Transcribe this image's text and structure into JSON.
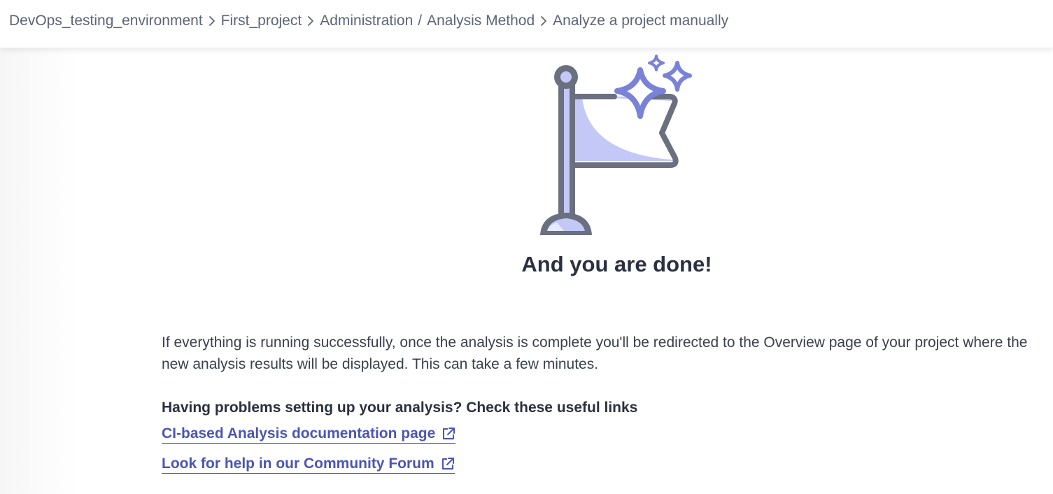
{
  "breadcrumb": {
    "items": [
      "DevOps_testing_environment",
      "First_project",
      "Administration",
      "Analysis Method",
      "Analyze a project manually"
    ],
    "separator": "/"
  },
  "illustration": {
    "icon": "flag-with-sparkles-icon",
    "colors": {
      "outline": "#6b7080",
      "flag_fill": "#c3c8f7",
      "sparkle": "#7a82d8"
    }
  },
  "main": {
    "title": "And you are done!",
    "info_text": "If everything is running successfully, once the analysis is complete you'll be redirected to the Overview page of your project where the new analysis results will be displayed. This can take a few minutes.",
    "help_heading": "Having problems setting up your analysis? Check these useful links",
    "links": [
      {
        "label": "CI-based Analysis documentation page",
        "icon": "external-link-icon"
      },
      {
        "label": "Look for help in our Community Forum",
        "icon": "external-link-icon"
      }
    ]
  },
  "colors": {
    "link": "#4b55b5",
    "text": "#3a3f4e",
    "heading": "#2b3040",
    "breadcrumb": "#5e6478"
  }
}
